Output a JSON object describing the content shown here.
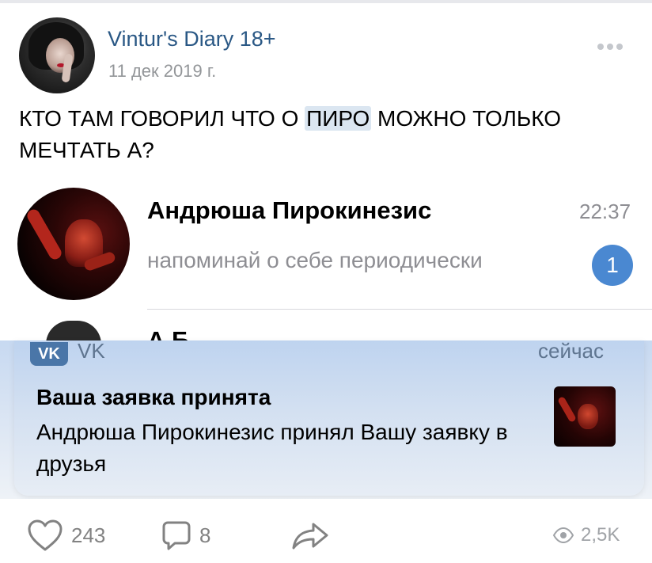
{
  "post": {
    "group_name": "Vintur's Diary 18+",
    "date": "11 дек 2019 г.",
    "text_before": "КТО ТАМ ГОВОРИЛ ЧТО О ",
    "text_highlight": "ПИРО",
    "text_after": " МОЖНО ТОЛЬКО МЕЧТАТЬ А?"
  },
  "chat": {
    "name": "Андрюша Пирокинезис",
    "time": "22:37",
    "message": "напоминай о себе периодически",
    "unread": "1",
    "next_name": "А                  Б"
  },
  "notification": {
    "app": "VK",
    "app_logo": "vk",
    "time": "сейчас",
    "title": "Ваша заявка принята",
    "body": "Андрюша Пирокинезис принял Вашу заявку в друзья"
  },
  "footer": {
    "likes": "243",
    "comments": "8",
    "views": "2,5K"
  },
  "colors": {
    "link": "#2a5885",
    "badge": "#4a88d1",
    "icon": "#828282"
  }
}
